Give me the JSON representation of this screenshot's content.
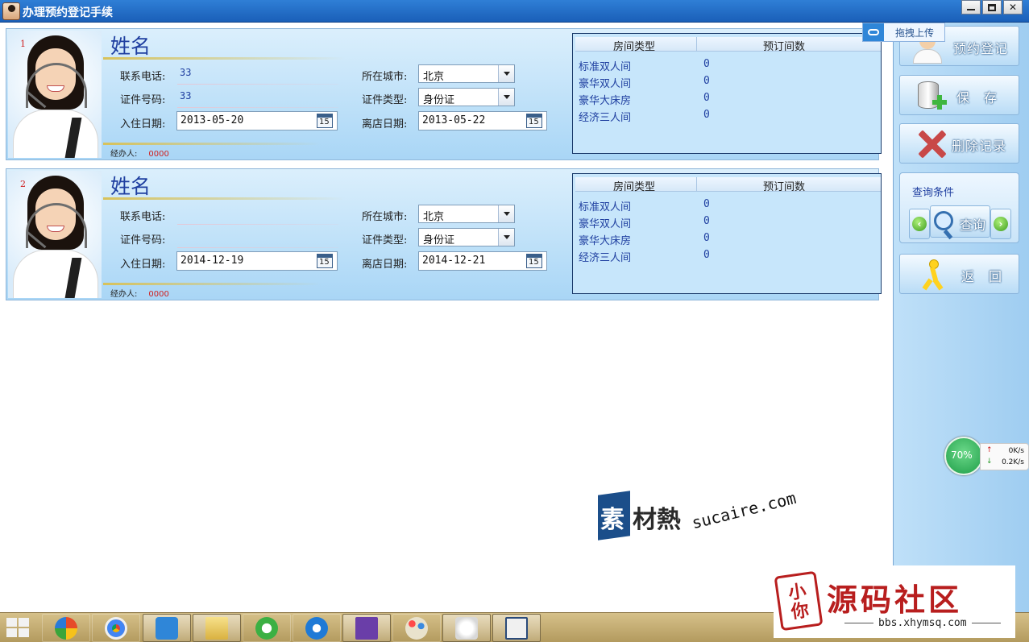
{
  "window": {
    "title": "办理预约登记手续"
  },
  "upload_badge": {
    "label": "拖拽上传"
  },
  "records": [
    {
      "index": "1",
      "name_title": "姓名",
      "phone_label": "联系电话:",
      "phone_value": "33",
      "id_label": "证件号码:",
      "id_value": "33",
      "checkin_label": "入住日期:",
      "checkin_date": "2013-05-20",
      "city_label": "所在城市:",
      "city_value": "北京",
      "idtype_label": "证件类型:",
      "idtype_value": "身份证",
      "checkout_label": "离店日期:",
      "checkout_date": "2013-05-22",
      "calendar_icon_text": "15",
      "handler_label": "经办人:",
      "handler_value": "0000",
      "room_table": {
        "col_room_type": "房间类型",
        "col_rooms": "预订间数",
        "rows": [
          {
            "type": "标准双人间",
            "count": "0"
          },
          {
            "type": "豪华双人间",
            "count": "0"
          },
          {
            "type": "豪华大床房",
            "count": "0"
          },
          {
            "type": "经济三人间",
            "count": "0"
          }
        ]
      }
    },
    {
      "index": "2",
      "name_title": "姓名",
      "phone_label": "联系电话:",
      "phone_value": "",
      "id_label": "证件号码:",
      "id_value": "",
      "checkin_label": "入住日期:",
      "checkin_date": "2014-12-19",
      "city_label": "所在城市:",
      "city_value": "北京",
      "idtype_label": "证件类型:",
      "idtype_value": "身份证",
      "checkout_label": "离店日期:",
      "checkout_date": "2014-12-21",
      "calendar_icon_text": "15",
      "handler_label": "经办人:",
      "handler_value": "0000",
      "room_table": {
        "col_room_type": "房间类型",
        "col_rooms": "预订间数",
        "rows": [
          {
            "type": "标准双人间",
            "count": "0"
          },
          {
            "type": "豪华双人间",
            "count": "0"
          },
          {
            "type": "豪华大床房",
            "count": "0"
          },
          {
            "type": "经济三人间",
            "count": "0"
          }
        ]
      }
    }
  ],
  "sidebar": {
    "register_label": "预约登记",
    "save_label": "保　存",
    "delete_label": "删除记录",
    "query_group_label": "查询条件",
    "query_button_label": "查询",
    "prev_glyph": "‹",
    "next_glyph": "›",
    "back_label": "返　回"
  },
  "net_meter": {
    "percent": "70%",
    "upload_arrow": "↑",
    "download_arrow": "↓",
    "upload_speed": "0K/s",
    "download_speed": "0.2K/s"
  },
  "watermark": {
    "mark_char1": "素",
    "mark_chars": "材熱",
    "url": "sucaire.com",
    "seal_chars": "小你",
    "site_name": "源码社区",
    "site_url": "bbs.xhymsq.com"
  },
  "icons": {
    "app": "agent-avatar-icon",
    "minimize": "minimize-icon",
    "maximize": "maximize-icon",
    "close": "close-icon",
    "calendar": "calendar-icon",
    "dropdown": "chevron-down-icon",
    "register": "receptionist-icon",
    "save": "database-add-icon",
    "delete": "delete-x-icon",
    "query": "magnifier-icon",
    "back": "running-man-icon",
    "upload": "cloud-icon"
  }
}
